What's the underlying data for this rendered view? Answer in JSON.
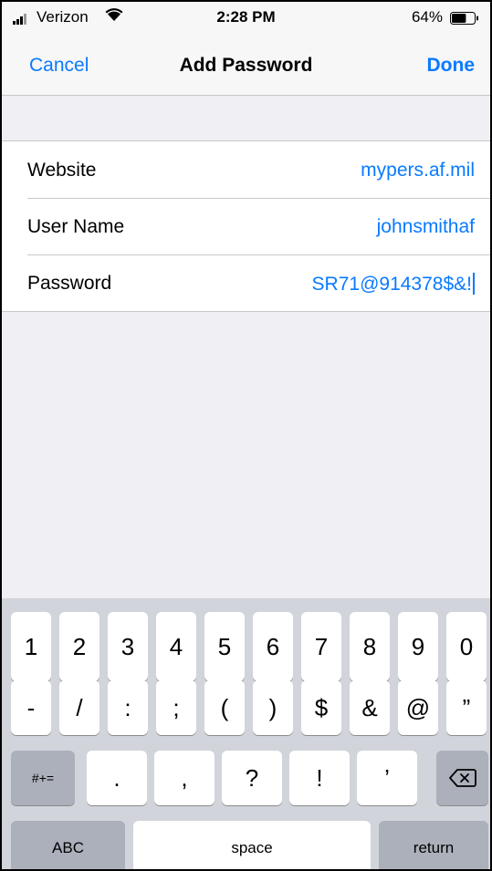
{
  "status_bar": {
    "carrier": "Verizon",
    "time": "2:28 PM",
    "battery_percent": "64%",
    "battery_level": 0.64,
    "icons": [
      "signal-icon",
      "wifi-icon",
      "battery-icon"
    ]
  },
  "nav": {
    "cancel_label": "Cancel",
    "title": "Add Password",
    "done_label": "Done"
  },
  "form": {
    "rows": [
      {
        "label": "Website",
        "value": "mypers.af.mil"
      },
      {
        "label": "User Name",
        "value": "johnsmithaf"
      },
      {
        "label": "Password",
        "value": "SR71@914378$&!"
      }
    ]
  },
  "keyboard": {
    "row1": [
      "1",
      "2",
      "3",
      "4",
      "5",
      "6",
      "7",
      "8",
      "9",
      "0"
    ],
    "row2": [
      "-",
      "/",
      ":",
      ";",
      "(",
      ")",
      "$",
      "&",
      "@",
      "”"
    ],
    "row3": [
      ".",
      ",",
      "?",
      "!",
      "’"
    ],
    "symbols_label": "#+=",
    "abc_label": "ABC",
    "space_label": "space",
    "return_label": "return",
    "delete_icon": "delete-backspace-icon"
  },
  "colors": {
    "accent": "#0a7aff",
    "background": "#efeff4",
    "keyboard": "#d1d4da"
  }
}
